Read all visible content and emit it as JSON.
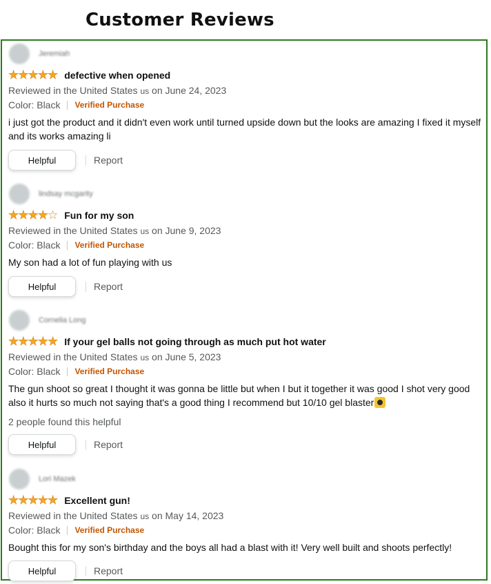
{
  "page": {
    "title": "Customer Reviews"
  },
  "actions": {
    "helpful_label": "Helpful",
    "report_label": "Report"
  },
  "colors": {
    "border": "#2b7a1d",
    "star": "#f5a623",
    "verified": "#c45500"
  },
  "reviews": [
    {
      "reviewer": "Jeremiah",
      "rating": 5,
      "title": "defective when opened",
      "meta_prefix": "Reviewed in the United States",
      "meta_us": "us",
      "meta_date": "on June 24, 2023",
      "color_label": "Color: Black",
      "verified": "Verified Purchase",
      "body": "i just got the product and it didn't even work until turned upside down but the looks are amazing I fixed it myself and its works amazing li",
      "helpful_count": ""
    },
    {
      "reviewer": "lindsay mcgarity",
      "rating": 4,
      "title": "Fun for my son",
      "meta_prefix": "Reviewed in the United States",
      "meta_us": "us",
      "meta_date": "on June 9, 2023",
      "color_label": "Color: Black",
      "verified": "Verified Purchase",
      "body": "My son had a lot of fun playing with us",
      "helpful_count": ""
    },
    {
      "reviewer": "Cornelia Long",
      "rating": 5,
      "title": "If your gel balls not going through as much put hot water",
      "meta_prefix": "Reviewed in the United States",
      "meta_us": "us",
      "meta_date": "on June 5, 2023",
      "color_label": "Color: Black",
      "verified": "Verified Purchase",
      "body": "The gun shoot so great I thought it was gonna be little but when I but it together it was good I shot very good also it hurts so much not saying that's a good thing I recommend but 10/10 gel blaster",
      "emoji": "face-emoji-icon",
      "helpful_count": "2 people found this helpful"
    },
    {
      "reviewer": "Lori Mazek",
      "rating": 5,
      "title": "Excellent gun!",
      "meta_prefix": "Reviewed in the United States",
      "meta_us": "us",
      "meta_date": "on May 14, 2023",
      "color_label": "Color: Black",
      "verified": "Verified Purchase",
      "body": "Bought this for my son's birthday and the boys all had a blast with it! Very well built and shoots perfectly!",
      "helpful_count": ""
    }
  ]
}
